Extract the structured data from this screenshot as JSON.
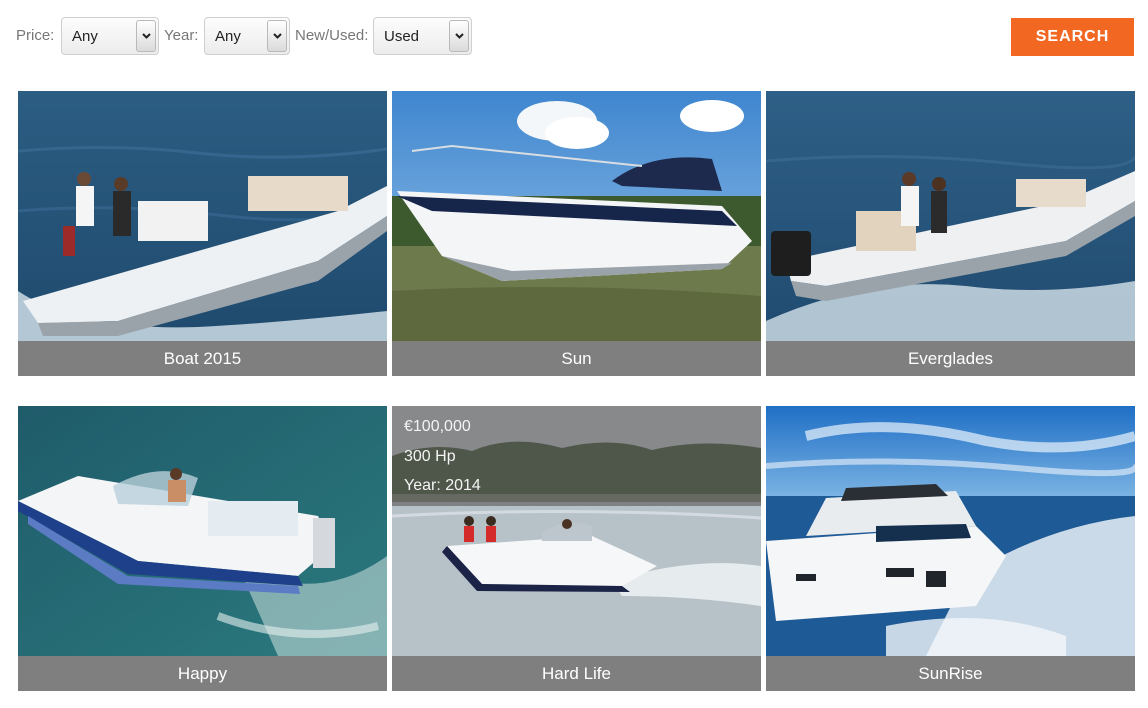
{
  "filters": {
    "price_label": "Price:",
    "price_value": "Any",
    "year_label": "Year:",
    "year_value": "Any",
    "condition_label": "New/Used:",
    "condition_value": "Used",
    "search_label": "SEARCH"
  },
  "colors": {
    "accent": "#f26722",
    "caption_bg": "#7f7f7f"
  },
  "listings": [
    {
      "title": "Boat 2015"
    },
    {
      "title": "Sun"
    },
    {
      "title": "Everglades"
    },
    {
      "title": "Happy"
    },
    {
      "title": "Hard Life",
      "hover": {
        "price": "€100,000",
        "power": "300 Hp",
        "year": "Year: 2014"
      }
    },
    {
      "title": "SunRise"
    }
  ]
}
